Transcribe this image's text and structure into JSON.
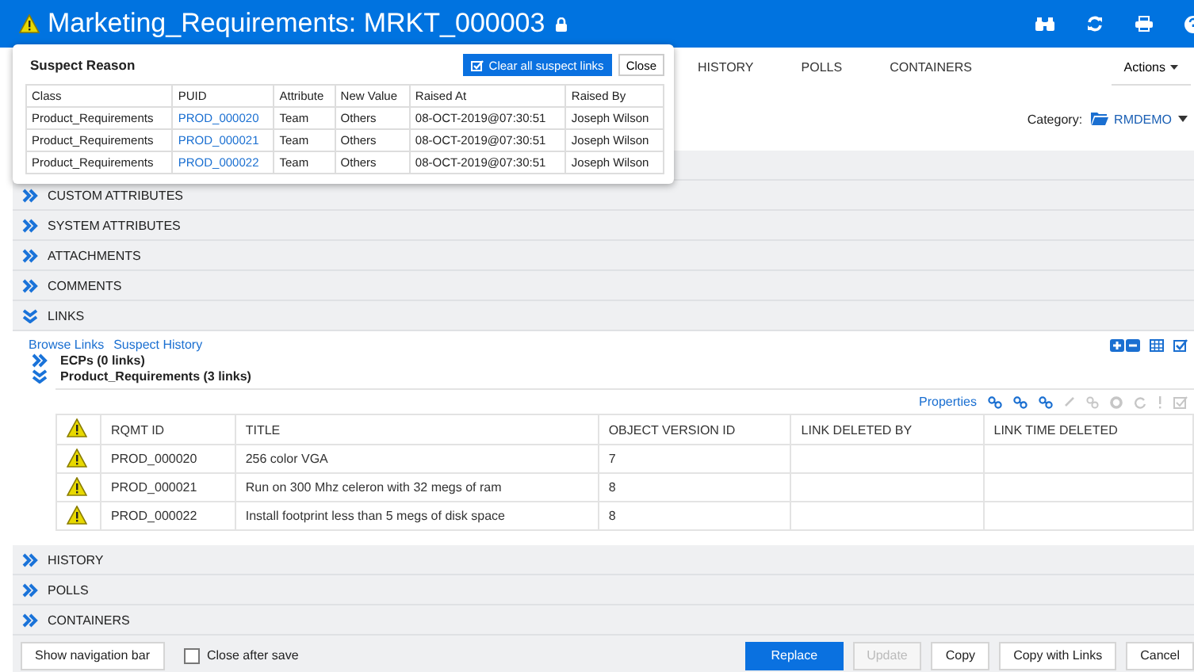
{
  "header": {
    "title": "Marketing_Requirements: MRKT_000003",
    "suspect": true,
    "locked": true
  },
  "tabs": [
    {
      "label": "HISTORY"
    },
    {
      "label": "POLLS"
    },
    {
      "label": "CONTAINERS"
    }
  ],
  "actions": {
    "label": "Actions"
  },
  "category": {
    "label": "Category:",
    "value": "RMDEMO"
  },
  "top_sections": [
    {
      "label": "CUSTOM ATTRIBUTES",
      "expanded": false
    },
    {
      "label": "SYSTEM ATTRIBUTES",
      "expanded": false
    },
    {
      "label": "ATTACHMENTS",
      "expanded": false
    },
    {
      "label": "COMMENTS",
      "expanded": false
    },
    {
      "label": "LINKS",
      "expanded": true
    }
  ],
  "links": {
    "nav": [
      "Browse Links",
      "Suspect History"
    ],
    "groups": [
      {
        "label": "ECPs (0 links)",
        "expanded": false
      },
      {
        "label": "Product_Requirements (3 links)",
        "expanded": true
      }
    ],
    "properties": "Properties",
    "columns": [
      "RQMT ID",
      "TITLE",
      "OBJECT VERSION ID",
      "LINK DELETED BY",
      "LINK TIME DELETED"
    ],
    "rows": [
      {
        "suspect": true,
        "rqmt_id": "PROD_000020",
        "title": "256 color VGA",
        "object_version_id": "7"
      },
      {
        "suspect": true,
        "rqmt_id": "PROD_000021",
        "title": "Run on 300 Mhz celeron with 32 megs of ram",
        "object_version_id": "8"
      },
      {
        "suspect": true,
        "rqmt_id": "PROD_000022",
        "title": "Install footprint less than 5 megs of disk space",
        "object_version_id": "8"
      }
    ]
  },
  "bottom_sections": [
    {
      "label": "HISTORY",
      "expanded": false
    },
    {
      "label": "POLLS",
      "expanded": false
    },
    {
      "label": "CONTAINERS",
      "expanded": false
    }
  ],
  "footer": {
    "nav_button": "Show navigation bar",
    "close_after_save": {
      "label": "Close after save",
      "checked": false
    },
    "buttons": [
      {
        "label": "Replace",
        "kind": "primary",
        "disabled": false
      },
      {
        "label": "Update",
        "kind": "default",
        "disabled": true
      },
      {
        "label": "Copy",
        "kind": "default",
        "disabled": false
      },
      {
        "label": "Copy with Links",
        "kind": "default",
        "disabled": false
      },
      {
        "label": "Cancel",
        "kind": "default",
        "disabled": false
      }
    ]
  },
  "suspect_popup": {
    "title": "Suspect Reason",
    "clear_button": "Clear all suspect links",
    "close_button": "Close",
    "columns": [
      "Class",
      "PUID",
      "Attribute",
      "New Value",
      "Raised At",
      "Raised By"
    ],
    "rows": [
      {
        "class": "Product_Requirements",
        "puid": "PROD_000020",
        "attribute": "Team",
        "new_value": "Others",
        "raised_at": "08-OCT-2019@07:30:51",
        "raised_by": "Joseph Wilson"
      },
      {
        "class": "Product_Requirements",
        "puid": "PROD_000021",
        "attribute": "Team",
        "new_value": "Others",
        "raised_at": "08-OCT-2019@07:30:51",
        "raised_by": "Joseph Wilson"
      },
      {
        "class": "Product_Requirements",
        "puid": "PROD_000022",
        "attribute": "Team",
        "new_value": "Others",
        "raised_at": "08-OCT-2019@07:30:51",
        "raised_by": "Joseph Wilson"
      }
    ]
  }
}
